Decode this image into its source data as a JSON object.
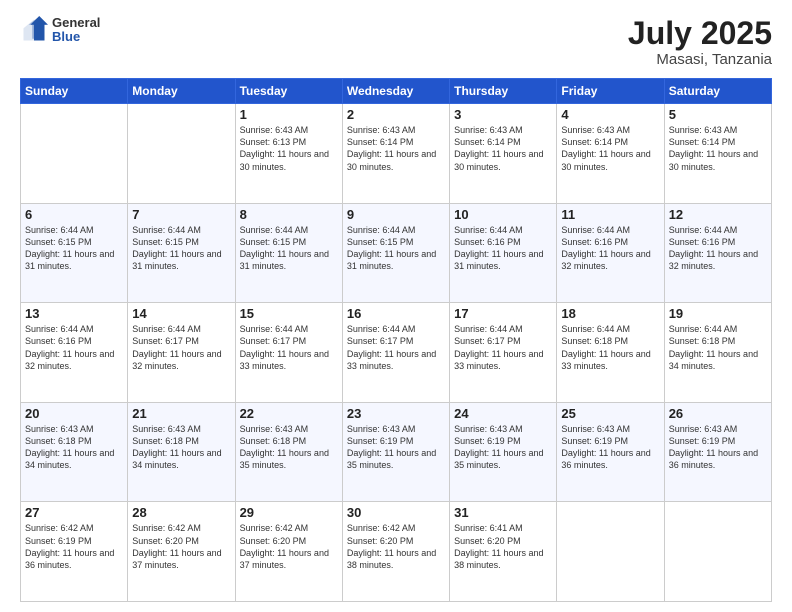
{
  "header": {
    "logo_general": "General",
    "logo_blue": "Blue",
    "title": "July 2025",
    "location": "Masasi, Tanzania"
  },
  "days_of_week": [
    "Sunday",
    "Monday",
    "Tuesday",
    "Wednesday",
    "Thursday",
    "Friday",
    "Saturday"
  ],
  "weeks": [
    [
      {
        "day": "",
        "info": ""
      },
      {
        "day": "",
        "info": ""
      },
      {
        "day": "1",
        "info": "Sunrise: 6:43 AM\nSunset: 6:13 PM\nDaylight: 11 hours and 30 minutes."
      },
      {
        "day": "2",
        "info": "Sunrise: 6:43 AM\nSunset: 6:14 PM\nDaylight: 11 hours and 30 minutes."
      },
      {
        "day": "3",
        "info": "Sunrise: 6:43 AM\nSunset: 6:14 PM\nDaylight: 11 hours and 30 minutes."
      },
      {
        "day": "4",
        "info": "Sunrise: 6:43 AM\nSunset: 6:14 PM\nDaylight: 11 hours and 30 minutes."
      },
      {
        "day": "5",
        "info": "Sunrise: 6:43 AM\nSunset: 6:14 PM\nDaylight: 11 hours and 30 minutes."
      }
    ],
    [
      {
        "day": "6",
        "info": "Sunrise: 6:44 AM\nSunset: 6:15 PM\nDaylight: 11 hours and 31 minutes."
      },
      {
        "day": "7",
        "info": "Sunrise: 6:44 AM\nSunset: 6:15 PM\nDaylight: 11 hours and 31 minutes."
      },
      {
        "day": "8",
        "info": "Sunrise: 6:44 AM\nSunset: 6:15 PM\nDaylight: 11 hours and 31 minutes."
      },
      {
        "day": "9",
        "info": "Sunrise: 6:44 AM\nSunset: 6:15 PM\nDaylight: 11 hours and 31 minutes."
      },
      {
        "day": "10",
        "info": "Sunrise: 6:44 AM\nSunset: 6:16 PM\nDaylight: 11 hours and 31 minutes."
      },
      {
        "day": "11",
        "info": "Sunrise: 6:44 AM\nSunset: 6:16 PM\nDaylight: 11 hours and 32 minutes."
      },
      {
        "day": "12",
        "info": "Sunrise: 6:44 AM\nSunset: 6:16 PM\nDaylight: 11 hours and 32 minutes."
      }
    ],
    [
      {
        "day": "13",
        "info": "Sunrise: 6:44 AM\nSunset: 6:16 PM\nDaylight: 11 hours and 32 minutes."
      },
      {
        "day": "14",
        "info": "Sunrise: 6:44 AM\nSunset: 6:17 PM\nDaylight: 11 hours and 32 minutes."
      },
      {
        "day": "15",
        "info": "Sunrise: 6:44 AM\nSunset: 6:17 PM\nDaylight: 11 hours and 33 minutes."
      },
      {
        "day": "16",
        "info": "Sunrise: 6:44 AM\nSunset: 6:17 PM\nDaylight: 11 hours and 33 minutes."
      },
      {
        "day": "17",
        "info": "Sunrise: 6:44 AM\nSunset: 6:17 PM\nDaylight: 11 hours and 33 minutes."
      },
      {
        "day": "18",
        "info": "Sunrise: 6:44 AM\nSunset: 6:18 PM\nDaylight: 11 hours and 33 minutes."
      },
      {
        "day": "19",
        "info": "Sunrise: 6:44 AM\nSunset: 6:18 PM\nDaylight: 11 hours and 34 minutes."
      }
    ],
    [
      {
        "day": "20",
        "info": "Sunrise: 6:43 AM\nSunset: 6:18 PM\nDaylight: 11 hours and 34 minutes."
      },
      {
        "day": "21",
        "info": "Sunrise: 6:43 AM\nSunset: 6:18 PM\nDaylight: 11 hours and 34 minutes."
      },
      {
        "day": "22",
        "info": "Sunrise: 6:43 AM\nSunset: 6:18 PM\nDaylight: 11 hours and 35 minutes."
      },
      {
        "day": "23",
        "info": "Sunrise: 6:43 AM\nSunset: 6:19 PM\nDaylight: 11 hours and 35 minutes."
      },
      {
        "day": "24",
        "info": "Sunrise: 6:43 AM\nSunset: 6:19 PM\nDaylight: 11 hours and 35 minutes."
      },
      {
        "day": "25",
        "info": "Sunrise: 6:43 AM\nSunset: 6:19 PM\nDaylight: 11 hours and 36 minutes."
      },
      {
        "day": "26",
        "info": "Sunrise: 6:43 AM\nSunset: 6:19 PM\nDaylight: 11 hours and 36 minutes."
      }
    ],
    [
      {
        "day": "27",
        "info": "Sunrise: 6:42 AM\nSunset: 6:19 PM\nDaylight: 11 hours and 36 minutes."
      },
      {
        "day": "28",
        "info": "Sunrise: 6:42 AM\nSunset: 6:20 PM\nDaylight: 11 hours and 37 minutes."
      },
      {
        "day": "29",
        "info": "Sunrise: 6:42 AM\nSunset: 6:20 PM\nDaylight: 11 hours and 37 minutes."
      },
      {
        "day": "30",
        "info": "Sunrise: 6:42 AM\nSunset: 6:20 PM\nDaylight: 11 hours and 38 minutes."
      },
      {
        "day": "31",
        "info": "Sunrise: 6:41 AM\nSunset: 6:20 PM\nDaylight: 11 hours and 38 minutes."
      },
      {
        "day": "",
        "info": ""
      },
      {
        "day": "",
        "info": ""
      }
    ]
  ]
}
